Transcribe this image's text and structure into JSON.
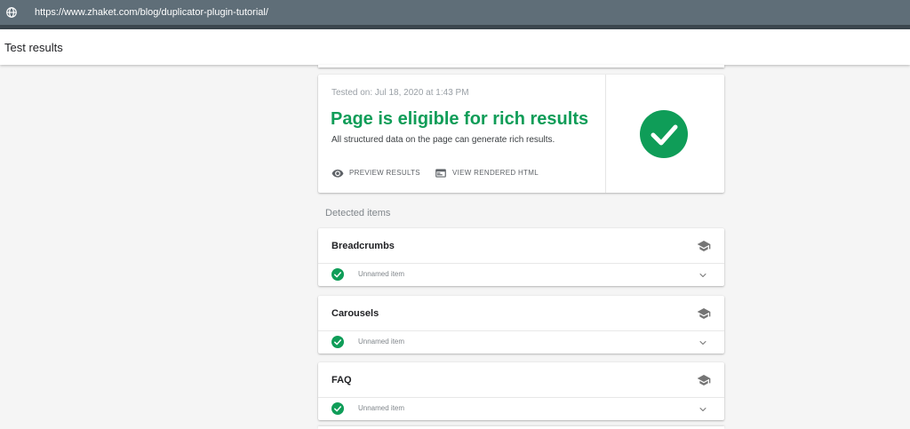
{
  "browser": {
    "url": "https://www.zhaket.com/blog/duplicator-plugin-tutorial/",
    "url_icon": "globe-icon"
  },
  "appbar": {
    "title": "Test results"
  },
  "summary": {
    "tested_on": "Tested on: Jul 18, 2020 at 1:43 PM",
    "headline": "Page is eligible for rich results",
    "description": "All structured data on the page can generate rich results.",
    "status_icon": "check-circle-icon",
    "actions": [
      {
        "label": "PREVIEW RESULTS",
        "icon": "eye-icon"
      },
      {
        "label": "VIEW RENDERED HTML",
        "icon": "web-page-icon"
      }
    ]
  },
  "detected": {
    "label": "Detected items",
    "items": [
      {
        "title": "Breadcrumbs",
        "row": "Unnamed item",
        "status": "valid"
      },
      {
        "title": "Carousels",
        "row": "Unnamed item",
        "status": "valid"
      },
      {
        "title": "FAQ",
        "row": "Unnamed item",
        "status": "valid"
      }
    ]
  },
  "colors": {
    "success": "#0f9d58",
    "url_bar": "#5f6e78",
    "background": "#f5f5f5"
  }
}
